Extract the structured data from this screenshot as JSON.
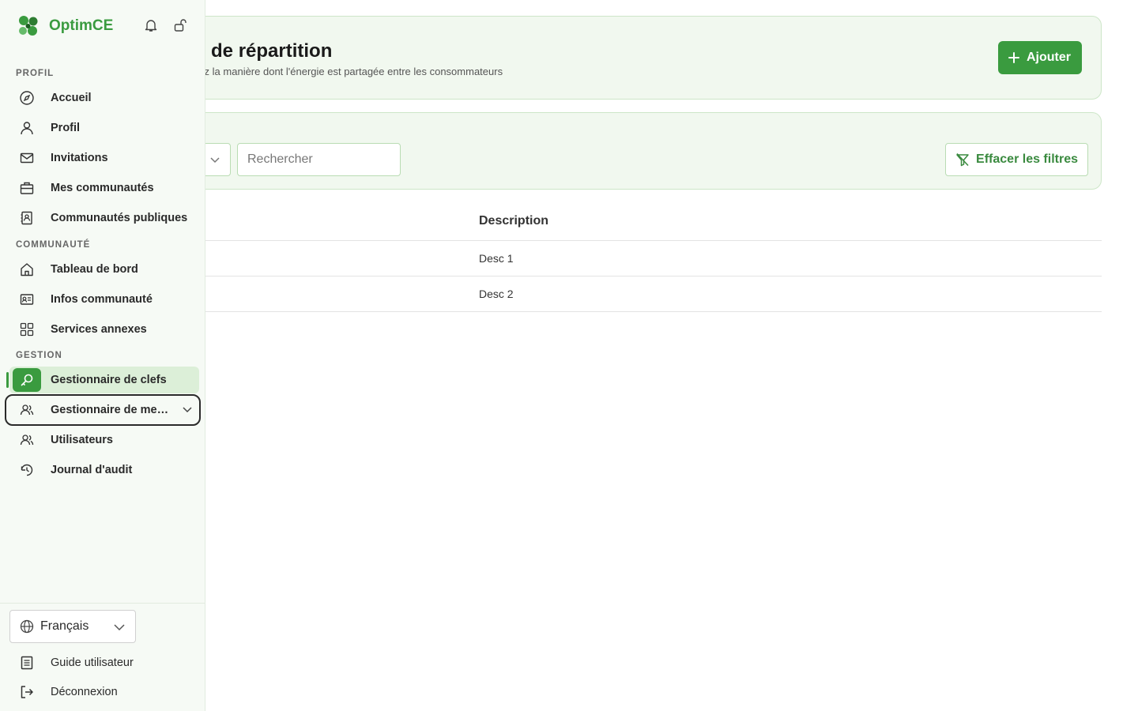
{
  "app": {
    "name": "OptimCE"
  },
  "header": {
    "title": "s de répartition",
    "subtitle": "rez la manière dont l'énergie est partagée entre les consommateurs",
    "add_label": "Ajouter"
  },
  "filters": {
    "search_placeholder": "Rechercher",
    "clear_label": "Effacer les filtres"
  },
  "table": {
    "columns": [
      "Description"
    ],
    "rows": [
      {
        "description": "Desc 1"
      },
      {
        "description": "Desc 2"
      }
    ]
  },
  "sidebar": {
    "sections": {
      "profil": "PROFIL",
      "communaute": "COMMUNAUTÉ",
      "gestion": "GESTION"
    },
    "items": [
      {
        "label": "Accueil",
        "icon": "compass-icon"
      },
      {
        "label": "Profil",
        "icon": "user-icon"
      },
      {
        "label": "Invitations",
        "icon": "mail-icon"
      },
      {
        "label": "Mes communautés",
        "icon": "briefcase-icon"
      },
      {
        "label": "Communautés publiques",
        "icon": "contact-book-icon"
      },
      {
        "label": "Tableau de bord",
        "icon": "home-icon"
      },
      {
        "label": "Infos communauté",
        "icon": "id-card-icon"
      },
      {
        "label": "Services annexes",
        "icon": "grid-icon"
      },
      {
        "label": "Gestionnaire de clefs",
        "icon": "key-icon"
      },
      {
        "label": "Gestionnaire de membres",
        "icon": "users-icon"
      },
      {
        "label": "Utilisateurs",
        "icon": "users-icon"
      },
      {
        "label": "Journal d'audit",
        "icon": "history-icon"
      }
    ],
    "language": "Français",
    "guide_label": "Guide utilisateur",
    "logout_label": "Déconnexion"
  },
  "colors": {
    "accent": "#3a9b3f",
    "card_bg": "#f1f8ef",
    "sidebar_bg": "#f6faf5"
  }
}
